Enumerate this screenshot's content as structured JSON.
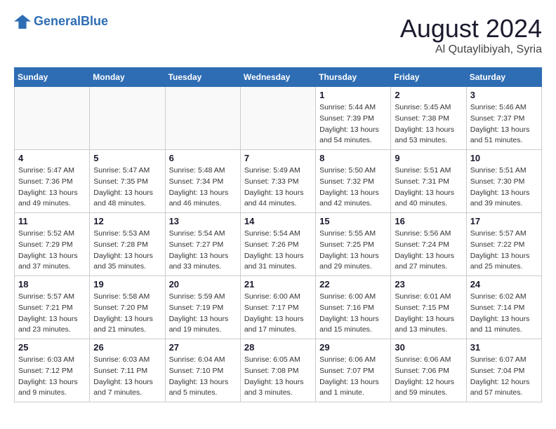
{
  "header": {
    "logo_general": "General",
    "logo_blue": "Blue",
    "month_title": "August 2024",
    "location": "Al Qutaylibiyah, Syria"
  },
  "weekdays": [
    "Sunday",
    "Monday",
    "Tuesday",
    "Wednesday",
    "Thursday",
    "Friday",
    "Saturday"
  ],
  "weeks": [
    [
      {
        "day": "",
        "info": ""
      },
      {
        "day": "",
        "info": ""
      },
      {
        "day": "",
        "info": ""
      },
      {
        "day": "",
        "info": ""
      },
      {
        "day": "1",
        "info": "Sunrise: 5:44 AM\nSunset: 7:39 PM\nDaylight: 13 hours\nand 54 minutes."
      },
      {
        "day": "2",
        "info": "Sunrise: 5:45 AM\nSunset: 7:38 PM\nDaylight: 13 hours\nand 53 minutes."
      },
      {
        "day": "3",
        "info": "Sunrise: 5:46 AM\nSunset: 7:37 PM\nDaylight: 13 hours\nand 51 minutes."
      }
    ],
    [
      {
        "day": "4",
        "info": "Sunrise: 5:47 AM\nSunset: 7:36 PM\nDaylight: 13 hours\nand 49 minutes."
      },
      {
        "day": "5",
        "info": "Sunrise: 5:47 AM\nSunset: 7:35 PM\nDaylight: 13 hours\nand 48 minutes."
      },
      {
        "day": "6",
        "info": "Sunrise: 5:48 AM\nSunset: 7:34 PM\nDaylight: 13 hours\nand 46 minutes."
      },
      {
        "day": "7",
        "info": "Sunrise: 5:49 AM\nSunset: 7:33 PM\nDaylight: 13 hours\nand 44 minutes."
      },
      {
        "day": "8",
        "info": "Sunrise: 5:50 AM\nSunset: 7:32 PM\nDaylight: 13 hours\nand 42 minutes."
      },
      {
        "day": "9",
        "info": "Sunrise: 5:51 AM\nSunset: 7:31 PM\nDaylight: 13 hours\nand 40 minutes."
      },
      {
        "day": "10",
        "info": "Sunrise: 5:51 AM\nSunset: 7:30 PM\nDaylight: 13 hours\nand 39 minutes."
      }
    ],
    [
      {
        "day": "11",
        "info": "Sunrise: 5:52 AM\nSunset: 7:29 PM\nDaylight: 13 hours\nand 37 minutes."
      },
      {
        "day": "12",
        "info": "Sunrise: 5:53 AM\nSunset: 7:28 PM\nDaylight: 13 hours\nand 35 minutes."
      },
      {
        "day": "13",
        "info": "Sunrise: 5:54 AM\nSunset: 7:27 PM\nDaylight: 13 hours\nand 33 minutes."
      },
      {
        "day": "14",
        "info": "Sunrise: 5:54 AM\nSunset: 7:26 PM\nDaylight: 13 hours\nand 31 minutes."
      },
      {
        "day": "15",
        "info": "Sunrise: 5:55 AM\nSunset: 7:25 PM\nDaylight: 13 hours\nand 29 minutes."
      },
      {
        "day": "16",
        "info": "Sunrise: 5:56 AM\nSunset: 7:24 PM\nDaylight: 13 hours\nand 27 minutes."
      },
      {
        "day": "17",
        "info": "Sunrise: 5:57 AM\nSunset: 7:22 PM\nDaylight: 13 hours\nand 25 minutes."
      }
    ],
    [
      {
        "day": "18",
        "info": "Sunrise: 5:57 AM\nSunset: 7:21 PM\nDaylight: 13 hours\nand 23 minutes."
      },
      {
        "day": "19",
        "info": "Sunrise: 5:58 AM\nSunset: 7:20 PM\nDaylight: 13 hours\nand 21 minutes."
      },
      {
        "day": "20",
        "info": "Sunrise: 5:59 AM\nSunset: 7:19 PM\nDaylight: 13 hours\nand 19 minutes."
      },
      {
        "day": "21",
        "info": "Sunrise: 6:00 AM\nSunset: 7:17 PM\nDaylight: 13 hours\nand 17 minutes."
      },
      {
        "day": "22",
        "info": "Sunrise: 6:00 AM\nSunset: 7:16 PM\nDaylight: 13 hours\nand 15 minutes."
      },
      {
        "day": "23",
        "info": "Sunrise: 6:01 AM\nSunset: 7:15 PM\nDaylight: 13 hours\nand 13 minutes."
      },
      {
        "day": "24",
        "info": "Sunrise: 6:02 AM\nSunset: 7:14 PM\nDaylight: 13 hours\nand 11 minutes."
      }
    ],
    [
      {
        "day": "25",
        "info": "Sunrise: 6:03 AM\nSunset: 7:12 PM\nDaylight: 13 hours\nand 9 minutes."
      },
      {
        "day": "26",
        "info": "Sunrise: 6:03 AM\nSunset: 7:11 PM\nDaylight: 13 hours\nand 7 minutes."
      },
      {
        "day": "27",
        "info": "Sunrise: 6:04 AM\nSunset: 7:10 PM\nDaylight: 13 hours\nand 5 minutes."
      },
      {
        "day": "28",
        "info": "Sunrise: 6:05 AM\nSunset: 7:08 PM\nDaylight: 13 hours\nand 3 minutes."
      },
      {
        "day": "29",
        "info": "Sunrise: 6:06 AM\nSunset: 7:07 PM\nDaylight: 13 hours\nand 1 minute."
      },
      {
        "day": "30",
        "info": "Sunrise: 6:06 AM\nSunset: 7:06 PM\nDaylight: 12 hours\nand 59 minutes."
      },
      {
        "day": "31",
        "info": "Sunrise: 6:07 AM\nSunset: 7:04 PM\nDaylight: 12 hours\nand 57 minutes."
      }
    ]
  ]
}
